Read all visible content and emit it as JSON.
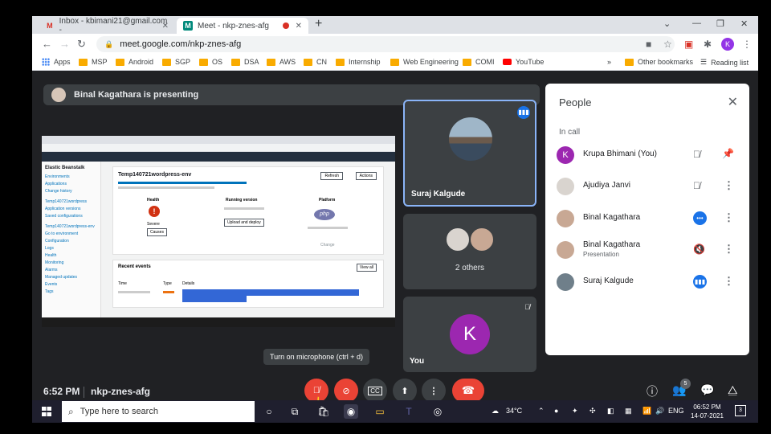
{
  "browser": {
    "tabs": [
      {
        "title": "Inbox - kbimani21@gmail.com -",
        "favicon": "M"
      },
      {
        "title": "Meet - nkp-znes-afg",
        "favicon": "M"
      }
    ],
    "url": "meet.google.com/nkp-znes-afg",
    "profile_initial": "K",
    "bookmarks": [
      "Apps",
      "MSP",
      "Android",
      "SGP",
      "OS",
      "DSA",
      "AWS",
      "CN",
      "Internship",
      "Web Engineering",
      "COMI",
      "YouTube"
    ],
    "other_bookmarks": "Other bookmarks",
    "reading_list": "Reading list",
    "more_chevron": "»"
  },
  "meet": {
    "presenting_banner": "Binal Kagathara is presenting",
    "tiles": {
      "speaker_name": "Suraj Kalgude",
      "others_label": "2 others",
      "self_label": "You",
      "self_initial": "K"
    },
    "tooltip": "Turn on microphone (ctrl + d)",
    "time": "6:52 PM",
    "meeting_code": "nkp-znes-afg",
    "participant_count": "5",
    "screen": {
      "sidebar_title": "Elastic Beanstalk",
      "sidebar_items": [
        "Environments",
        "Applications",
        "Change history",
        "Temp140721wordpress",
        "Application versions",
        "Saved configurations",
        "Temp140721wordpress-env",
        "Go to environment",
        "Configuration",
        "Logs",
        "Health",
        "Monitoring",
        "Alarms",
        "Managed updates",
        "Events",
        "Tags"
      ],
      "env_name": "Temp140721wordpress-env",
      "health_label": "Health",
      "health_value": "Severe",
      "running_label": "Running version",
      "platform_label": "Platform",
      "platform_logo": "php",
      "events_title": "Recent events",
      "refresh_label": "Refresh",
      "actions_label": "Actions",
      "causes_label": "Causes",
      "upload_label": "Upload and deploy",
      "change_label": "Change",
      "view_all_label": "View all",
      "event_headers": [
        "Time",
        "Type",
        "Details"
      ]
    }
  },
  "people_panel": {
    "title": "People",
    "section": "In call",
    "participants": [
      {
        "name": "Krupa Bhimani (You)",
        "initial": "K",
        "sub": "",
        "color": "#9c27b0"
      },
      {
        "name": "Ajudiya Janvi",
        "initial": "",
        "sub": "",
        "color": "#d9d4cf"
      },
      {
        "name": "Binal Kagathara",
        "initial": "",
        "sub": "",
        "color": "#c8a894"
      },
      {
        "name": "Binal Kagathara",
        "initial": "",
        "sub": "Presentation",
        "color": "#c8a894"
      },
      {
        "name": "Suraj Kalgude",
        "initial": "",
        "sub": "",
        "color": "#6f7f8a"
      }
    ]
  },
  "taskbar": {
    "search_placeholder": "Type here to search",
    "weather": "34°C",
    "language": "ENG",
    "time": "06:52 PM",
    "date": "14-07-2021",
    "notification_count": "3"
  }
}
